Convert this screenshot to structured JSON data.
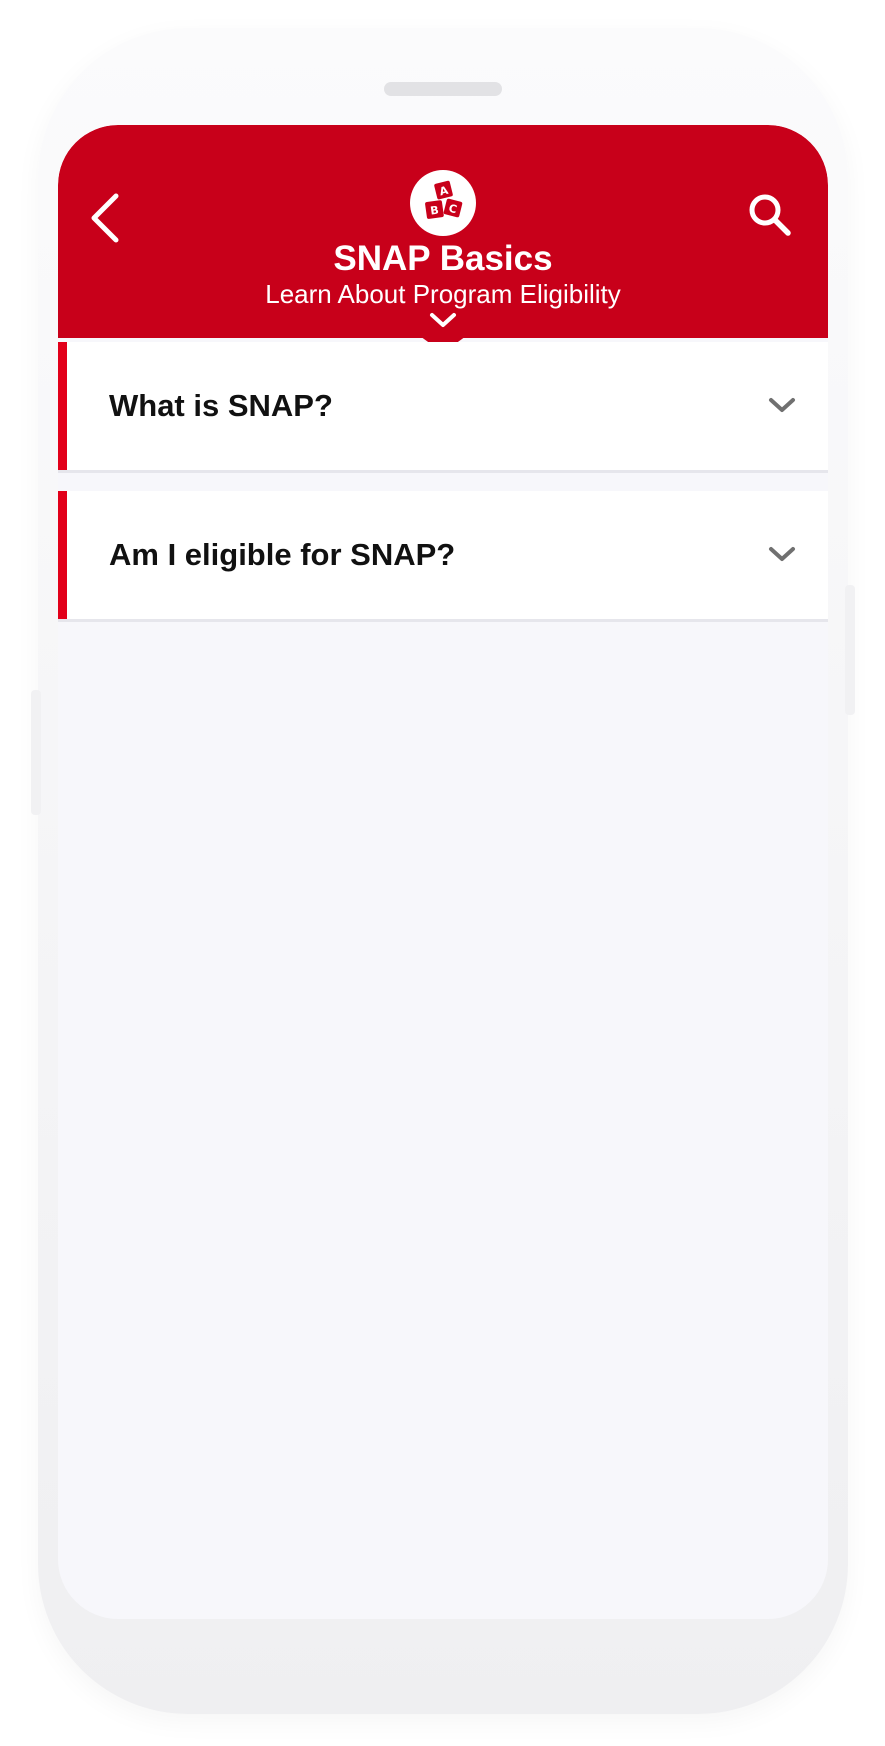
{
  "header": {
    "title": "SNAP Basics",
    "subtitle": "Learn About Program Eligibility",
    "badge_icon": "abc-blocks-icon",
    "back_icon": "chevron-left-icon",
    "search_icon": "search-icon",
    "expand_icon": "chevron-down-icon",
    "background_color": "#c8001a"
  },
  "accordion": {
    "items": [
      {
        "label": "What is SNAP?",
        "expanded": false,
        "icon": "chevron-down-icon"
      },
      {
        "label": "Am I eligible for SNAP?",
        "expanded": false,
        "icon": "chevron-down-icon"
      }
    ],
    "accent_color": "#e2001a"
  }
}
